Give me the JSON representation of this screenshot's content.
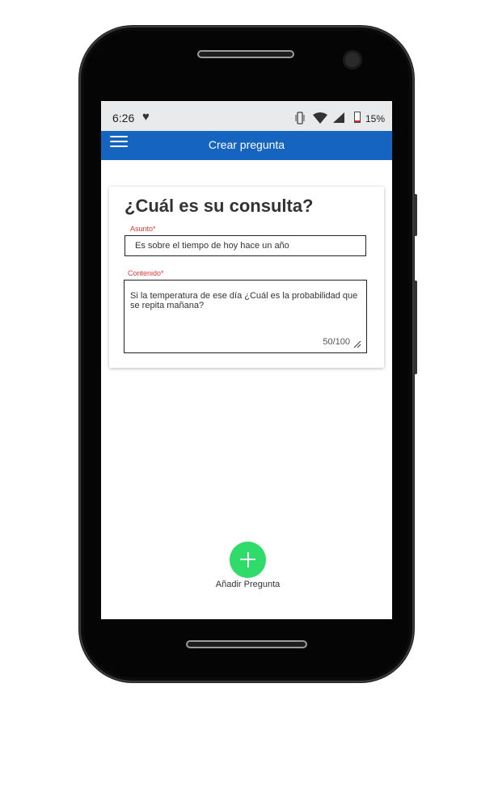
{
  "status_bar": {
    "time": "6:26",
    "battery_percent": "15%",
    "battery_level": 0.15,
    "icons": [
      "heart-icon",
      "vibrate-icon",
      "wifi-icon",
      "signal-icon",
      "battery-icon"
    ]
  },
  "app_bar": {
    "title": "Crear pregunta",
    "menu_icon": "hamburger-menu-icon",
    "color": "#1565c0"
  },
  "form": {
    "heading": "¿Cuál es su consulta?",
    "subject_label": "Asunto*",
    "subject_value": "Es sobre el tiempo de hoy hace un año",
    "content_label": "Contenido*",
    "content_value": "Si la temperatura de ese día ¿Cuál es la probabilidad que se repita mañana?",
    "counter": "50/100",
    "label_color": "#e53935"
  },
  "fab": {
    "label": "Añadir Pregunta",
    "icon": "plus-icon",
    "color": "#2fdc6a"
  }
}
